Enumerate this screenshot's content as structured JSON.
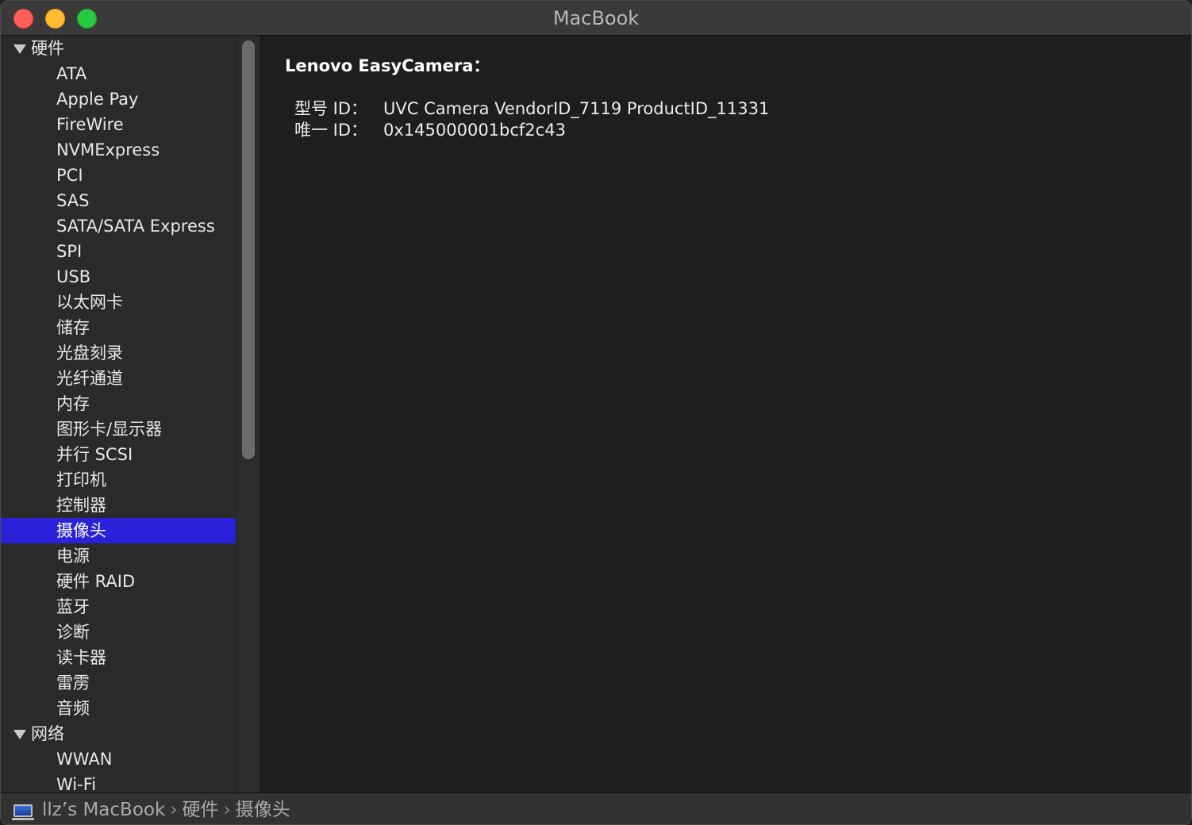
{
  "window": {
    "title": "MacBook"
  },
  "sidebar": {
    "groups": [
      {
        "label": "硬件",
        "items": [
          "ATA",
          "Apple Pay",
          "FireWire",
          "NVMExpress",
          "PCI",
          "SAS",
          "SATA/SATA Express",
          "SPI",
          "USB",
          "以太网卡",
          "储存",
          "光盘刻录",
          "光纤通道",
          "内存",
          "图形卡/显示器",
          "并行 SCSI",
          "打印机",
          "控制器",
          "摄像头",
          "电源",
          "硬件 RAID",
          "蓝牙",
          "诊断",
          "读卡器",
          "雷雳",
          "音频"
        ]
      },
      {
        "label": "网络",
        "items": [
          "WWAN",
          "Wi-Fi"
        ]
      }
    ],
    "selected": "摄像头"
  },
  "content": {
    "device_name": "Lenovo EasyCamera：",
    "properties": [
      {
        "label": "型号 ID：",
        "value": "UVC Camera VendorID_7119 ProductID_11331"
      },
      {
        "label": "唯一 ID：",
        "value": "0x145000001bcf2c43"
      }
    ]
  },
  "statusbar": {
    "icon": "macbook-icon",
    "path": [
      "llz’s MacBook",
      "硬件",
      "摄像头"
    ],
    "separator": "›"
  }
}
